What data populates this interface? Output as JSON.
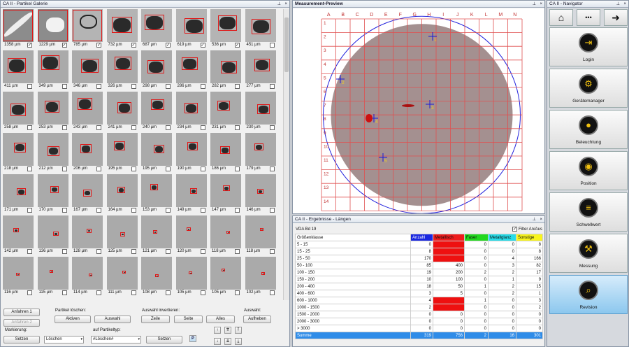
{
  "gallery": {
    "title": "CA II - Partikel Galerie",
    "items": [
      {
        "size": "1358 µm",
        "checked": true
      },
      {
        "size": "1229 µm",
        "checked": true
      },
      {
        "size": "785 µm",
        "checked": true
      },
      {
        "size": "732 µm",
        "checked": true
      },
      {
        "size": "687 µm",
        "checked": true
      },
      {
        "size": "619 µm",
        "checked": true
      },
      {
        "size": "536 µm",
        "checked": true
      },
      {
        "size": "451 µm",
        "checked": false
      },
      {
        "size": "411 µm",
        "checked": false
      },
      {
        "size": "349 µm",
        "checked": false
      },
      {
        "size": "346 µm",
        "checked": false
      },
      {
        "size": "326 µm",
        "checked": false
      },
      {
        "size": "298 µm",
        "checked": false
      },
      {
        "size": "286 µm",
        "checked": false
      },
      {
        "size": "282 µm",
        "checked": false
      },
      {
        "size": "277 µm",
        "checked": false
      },
      {
        "size": "258 µm",
        "checked": false
      },
      {
        "size": "253 µm",
        "checked": false
      },
      {
        "size": "243 µm",
        "checked": false
      },
      {
        "size": "241 µm",
        "checked": false
      },
      {
        "size": "240 µm",
        "checked": false
      },
      {
        "size": "234 µm",
        "checked": false
      },
      {
        "size": "231 µm",
        "checked": false
      },
      {
        "size": "230 µm",
        "checked": false
      },
      {
        "size": "218 µm",
        "checked": false
      },
      {
        "size": "212 µm",
        "checked": false
      },
      {
        "size": "206 µm",
        "checked": false
      },
      {
        "size": "195 µm",
        "checked": false
      },
      {
        "size": "195 µm",
        "checked": false
      },
      {
        "size": "190 µm",
        "checked": false
      },
      {
        "size": "186 µm",
        "checked": false
      },
      {
        "size": "179 µm",
        "checked": false
      },
      {
        "size": "171 µm",
        "checked": false
      },
      {
        "size": "170 µm",
        "checked": false
      },
      {
        "size": "167 µm",
        "checked": false
      },
      {
        "size": "164 µm",
        "checked": false
      },
      {
        "size": "153 µm",
        "checked": false
      },
      {
        "size": "149 µm",
        "checked": false
      },
      {
        "size": "147 µm",
        "checked": false
      },
      {
        "size": "146 µm",
        "checked": false
      },
      {
        "size": "142 µm",
        "checked": false
      },
      {
        "size": "136 µm",
        "checked": false
      },
      {
        "size": "128 µm",
        "checked": false
      },
      {
        "size": "125 µm",
        "checked": false
      },
      {
        "size": "121 µm",
        "checked": false
      },
      {
        "size": "120 µm",
        "checked": false
      },
      {
        "size": "118 µm",
        "checked": false
      },
      {
        "size": "118 µm",
        "checked": false
      },
      {
        "size": "116 µm",
        "checked": false
      },
      {
        "size": "115 µm",
        "checked": false
      },
      {
        "size": "114 µm",
        "checked": false
      },
      {
        "size": "111 µm",
        "checked": false
      },
      {
        "size": "108 µm",
        "checked": false
      },
      {
        "size": "105 µm",
        "checked": false
      },
      {
        "size": "105 µm",
        "checked": false
      },
      {
        "size": "102 µm",
        "checked": false
      }
    ],
    "controls": {
      "btn_anfahren1": "Anfahren 1",
      "btn_anfahren2": "Anfahren 2",
      "label_loeschen": "Partikel löschen:",
      "btn_aktiven": "Aktiven",
      "btn_auswahl": "Auswahl",
      "label_invertieren": "Auswahl invertieren:",
      "btn_zeile": "Zeile",
      "btn_seite": "Seite",
      "btn_alles": "Alles",
      "label_auswahl": "Auswahl:",
      "btn_aufheben": "Aufheben",
      "label_markierung": "Markierung:",
      "btn_setzen1": "Setzen",
      "select_loeschen": "Löschen",
      "label_partikeltyp": "auf Partikeltyp:",
      "select_typ": "#Löschen#",
      "btn_setzen2": "Setzen",
      "btn_p": "P"
    }
  },
  "preview": {
    "title": "Measurement-Preview",
    "cols": [
      "A",
      "B",
      "C",
      "D",
      "E",
      "F",
      "G",
      "H",
      "I",
      "J",
      "K",
      "L",
      "M",
      "N"
    ],
    "rows": [
      "1",
      "2",
      "3",
      "4",
      "5",
      "6",
      "7",
      "8",
      "9",
      "10",
      "11",
      "12",
      "13",
      "14"
    ],
    "markers": [
      "1",
      "2",
      "3",
      "4",
      "5"
    ]
  },
  "results": {
    "title": "CA II - Ergebnisse - Längen",
    "standard": "VDA Bd 19",
    "filter_label": "Filter An/Aus",
    "filter_checked": true,
    "headers": [
      "Größenklasse",
      "Anzahl",
      "Metallisch",
      "Faser",
      "Metallglanz",
      "Sonstige"
    ],
    "header_colors": [
      "#ffffff",
      "#1a28e0",
      "#ee1c1c",
      "#22d81e",
      "#26dce8",
      "#f8f41c"
    ],
    "rows": [
      [
        "5 - 15",
        "0",
        "",
        "0",
        "0",
        "8"
      ],
      [
        "15 - 25",
        "8",
        "",
        "0",
        "0",
        "8"
      ],
      [
        "25 - 50",
        "170",
        "",
        "0",
        "4",
        "166"
      ],
      [
        "50 - 100",
        "85",
        "400",
        "0",
        "3",
        "82"
      ],
      [
        "100 - 150",
        "19",
        "200",
        "2",
        "2",
        "17"
      ],
      [
        "150 - 200",
        "10",
        "100",
        "0",
        "1",
        "9"
      ],
      [
        "200 - 400",
        "18",
        "50",
        "1",
        "2",
        "15"
      ],
      [
        "400 - 600",
        "3",
        "5",
        "0",
        "2",
        "1"
      ],
      [
        "600 - 1000",
        "4",
        "",
        "1",
        "0",
        "3"
      ],
      [
        "1000 - 1500",
        "2",
        "",
        "0",
        "0",
        "2"
      ],
      [
        "1500 - 2000",
        "0",
        "0",
        "0",
        "0",
        "0"
      ],
      [
        "2000 - 3000",
        "0",
        "0",
        "0",
        "0",
        "0"
      ],
      [
        "> 3000",
        "0",
        "0",
        "0",
        "0",
        "0"
      ],
      [
        "Summe",
        "319",
        "756",
        "2",
        "16",
        "301"
      ]
    ]
  },
  "navigator": {
    "title": "CA II - Navigator",
    "top": [
      "home-icon",
      "more-icon",
      "arrow-right-icon"
    ],
    "top_glyphs": [
      "⌂",
      "•••",
      "➜"
    ],
    "items": [
      {
        "label": "Login",
        "icon": "login-icon",
        "glyph": "⇥"
      },
      {
        "label": "Gerätemanager",
        "icon": "device-manager-icon",
        "glyph": "⚙"
      },
      {
        "label": "Beleuchtung",
        "icon": "lightbulb-icon",
        "glyph": "●"
      },
      {
        "label": "Position",
        "icon": "position-icon",
        "glyph": "◉"
      },
      {
        "label": "Schwellwert",
        "icon": "threshold-icon",
        "glyph": "≡"
      },
      {
        "label": "Messung",
        "icon": "measurement-icon",
        "glyph": "⚒"
      },
      {
        "label": "Revision",
        "icon": "revision-icon",
        "glyph": "⌕"
      }
    ]
  }
}
